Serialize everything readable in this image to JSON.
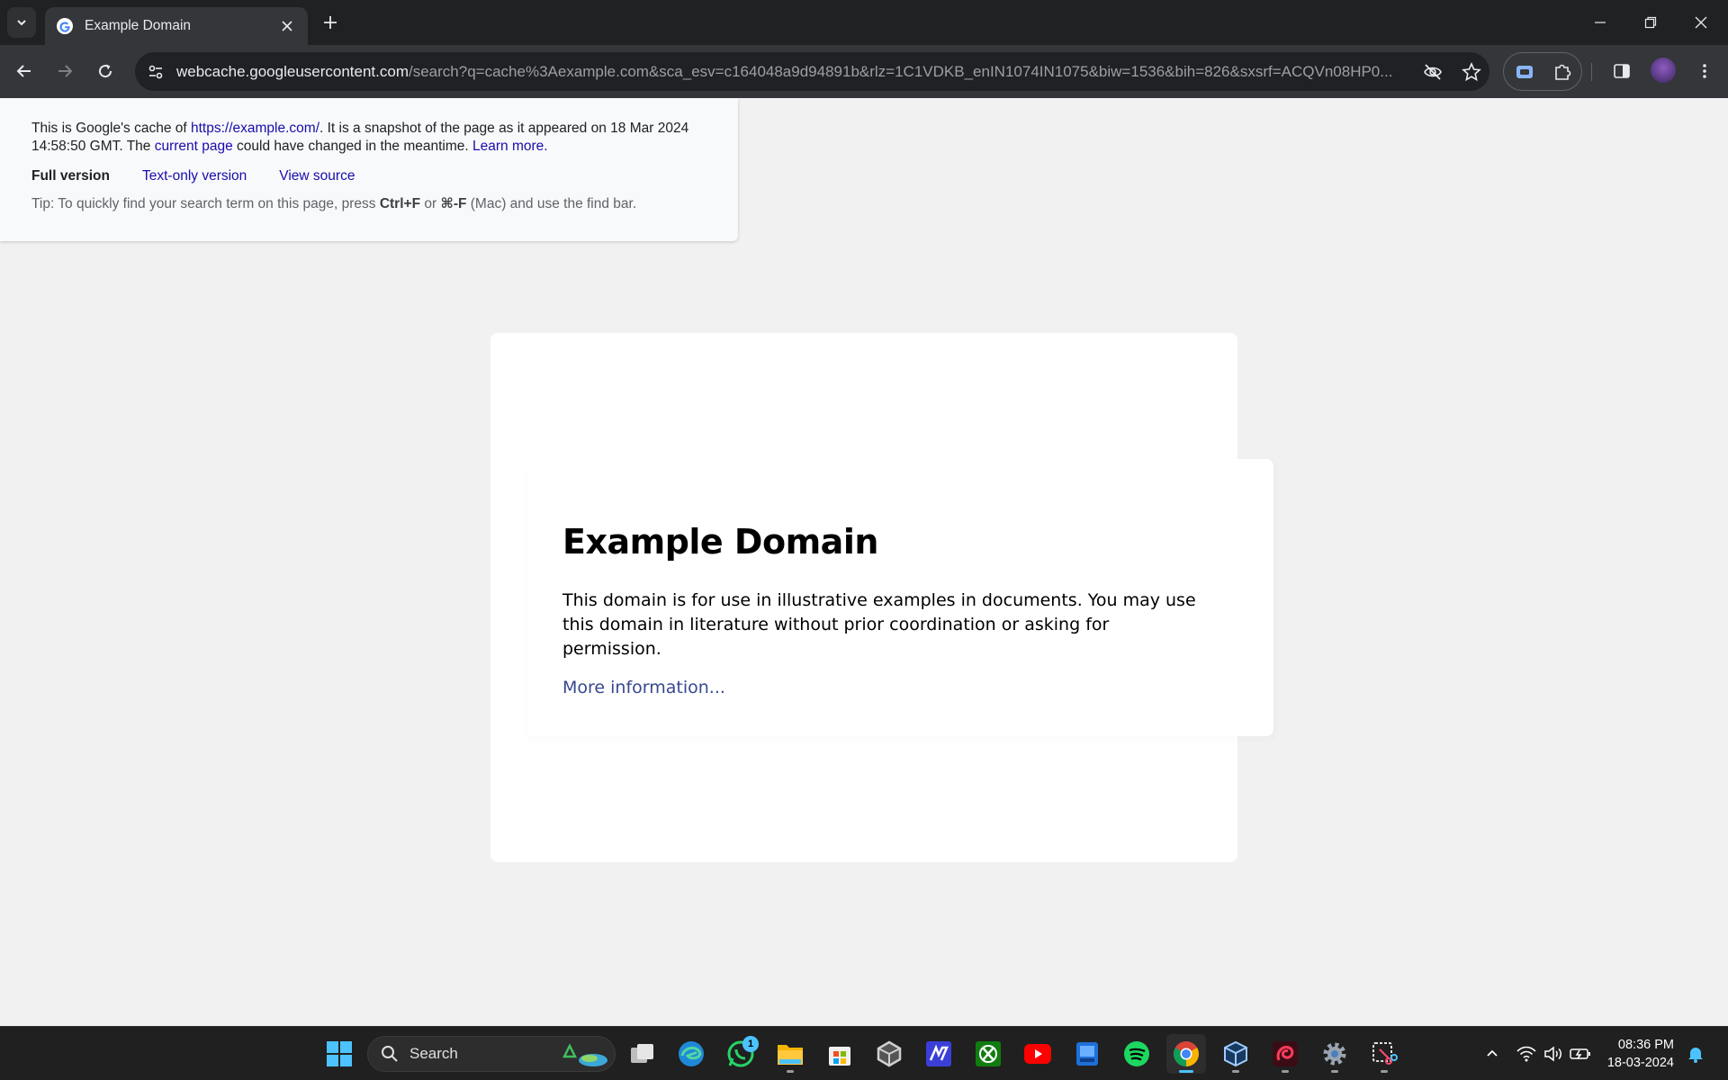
{
  "browser": {
    "tab_title": "Example Domain",
    "url_host": "webcache.googleusercontent.com",
    "url_path": "/search?q=cache%3Aexample.com&sca_esv=c164048a9d94891b&rlz=1C1VDKB_enIN1074IN1075&biw=1536&bih=826&sxsrf=ACQVn08HP0..."
  },
  "cache_banner": {
    "intro": "This is Google's cache of ",
    "cached_url": "https://example.com/",
    "snapshot_text": ". It is a snapshot of the page as it appeared on 18 Mar 2024 14:58:50 GMT. The ",
    "current_page_link": "current page",
    "changed_text": " could have changed in the meantime. ",
    "learn_more_link": "Learn more.",
    "tabs": [
      "Full version",
      "Text-only version",
      "View source"
    ],
    "tip_prefix": "Tip: To quickly find your search term on this page, press ",
    "tip_key1": "Ctrl+F",
    "tip_or": " or ",
    "tip_key2": "⌘-F",
    "tip_suffix": " (Mac) and use the find bar."
  },
  "page": {
    "heading": "Example Domain",
    "paragraph": "This domain is for use in illustrative examples in documents. You may use this domain in literature without prior coordination or asking for permission.",
    "link_text": "More information..."
  },
  "taskbar": {
    "search_label": "Search",
    "whatsapp_badge": "1",
    "time": "08:36 PM",
    "date": "18-03-2024"
  },
  "colors": {
    "link": "#1a0dab",
    "page_link": "#38488f",
    "active_indicator": "#4cc2ff"
  }
}
